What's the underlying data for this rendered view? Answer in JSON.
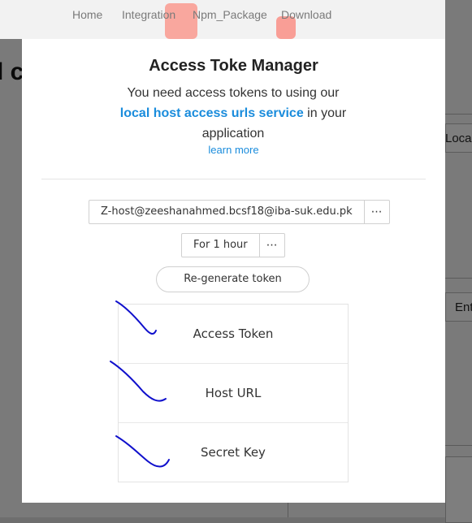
{
  "nav": {
    "items": [
      "Home",
      "Integration",
      "Npm_Package",
      "Download"
    ]
  },
  "background": {
    "heading": "l c",
    "right_text_1": "Local",
    "right_text_2": "Ent"
  },
  "modal": {
    "title": "Access Toke Manager",
    "desc_before": "You need access tokens to using our ",
    "desc_link": "local host access urls service",
    "desc_after": " in your application",
    "learn_more": "learn more",
    "host_select": "Z-host@zeeshanahmed.bcsf18@iba-suk.edu.pk",
    "duration_select": "For 1 hour",
    "more_glyph": "⋯",
    "regenerate_label": "Re-generate token",
    "token_rows": [
      "Access Token",
      "Host URL",
      "Secret Key"
    ]
  },
  "colors": {
    "link": "#1a8cdc",
    "scribble": "#1010cc"
  }
}
